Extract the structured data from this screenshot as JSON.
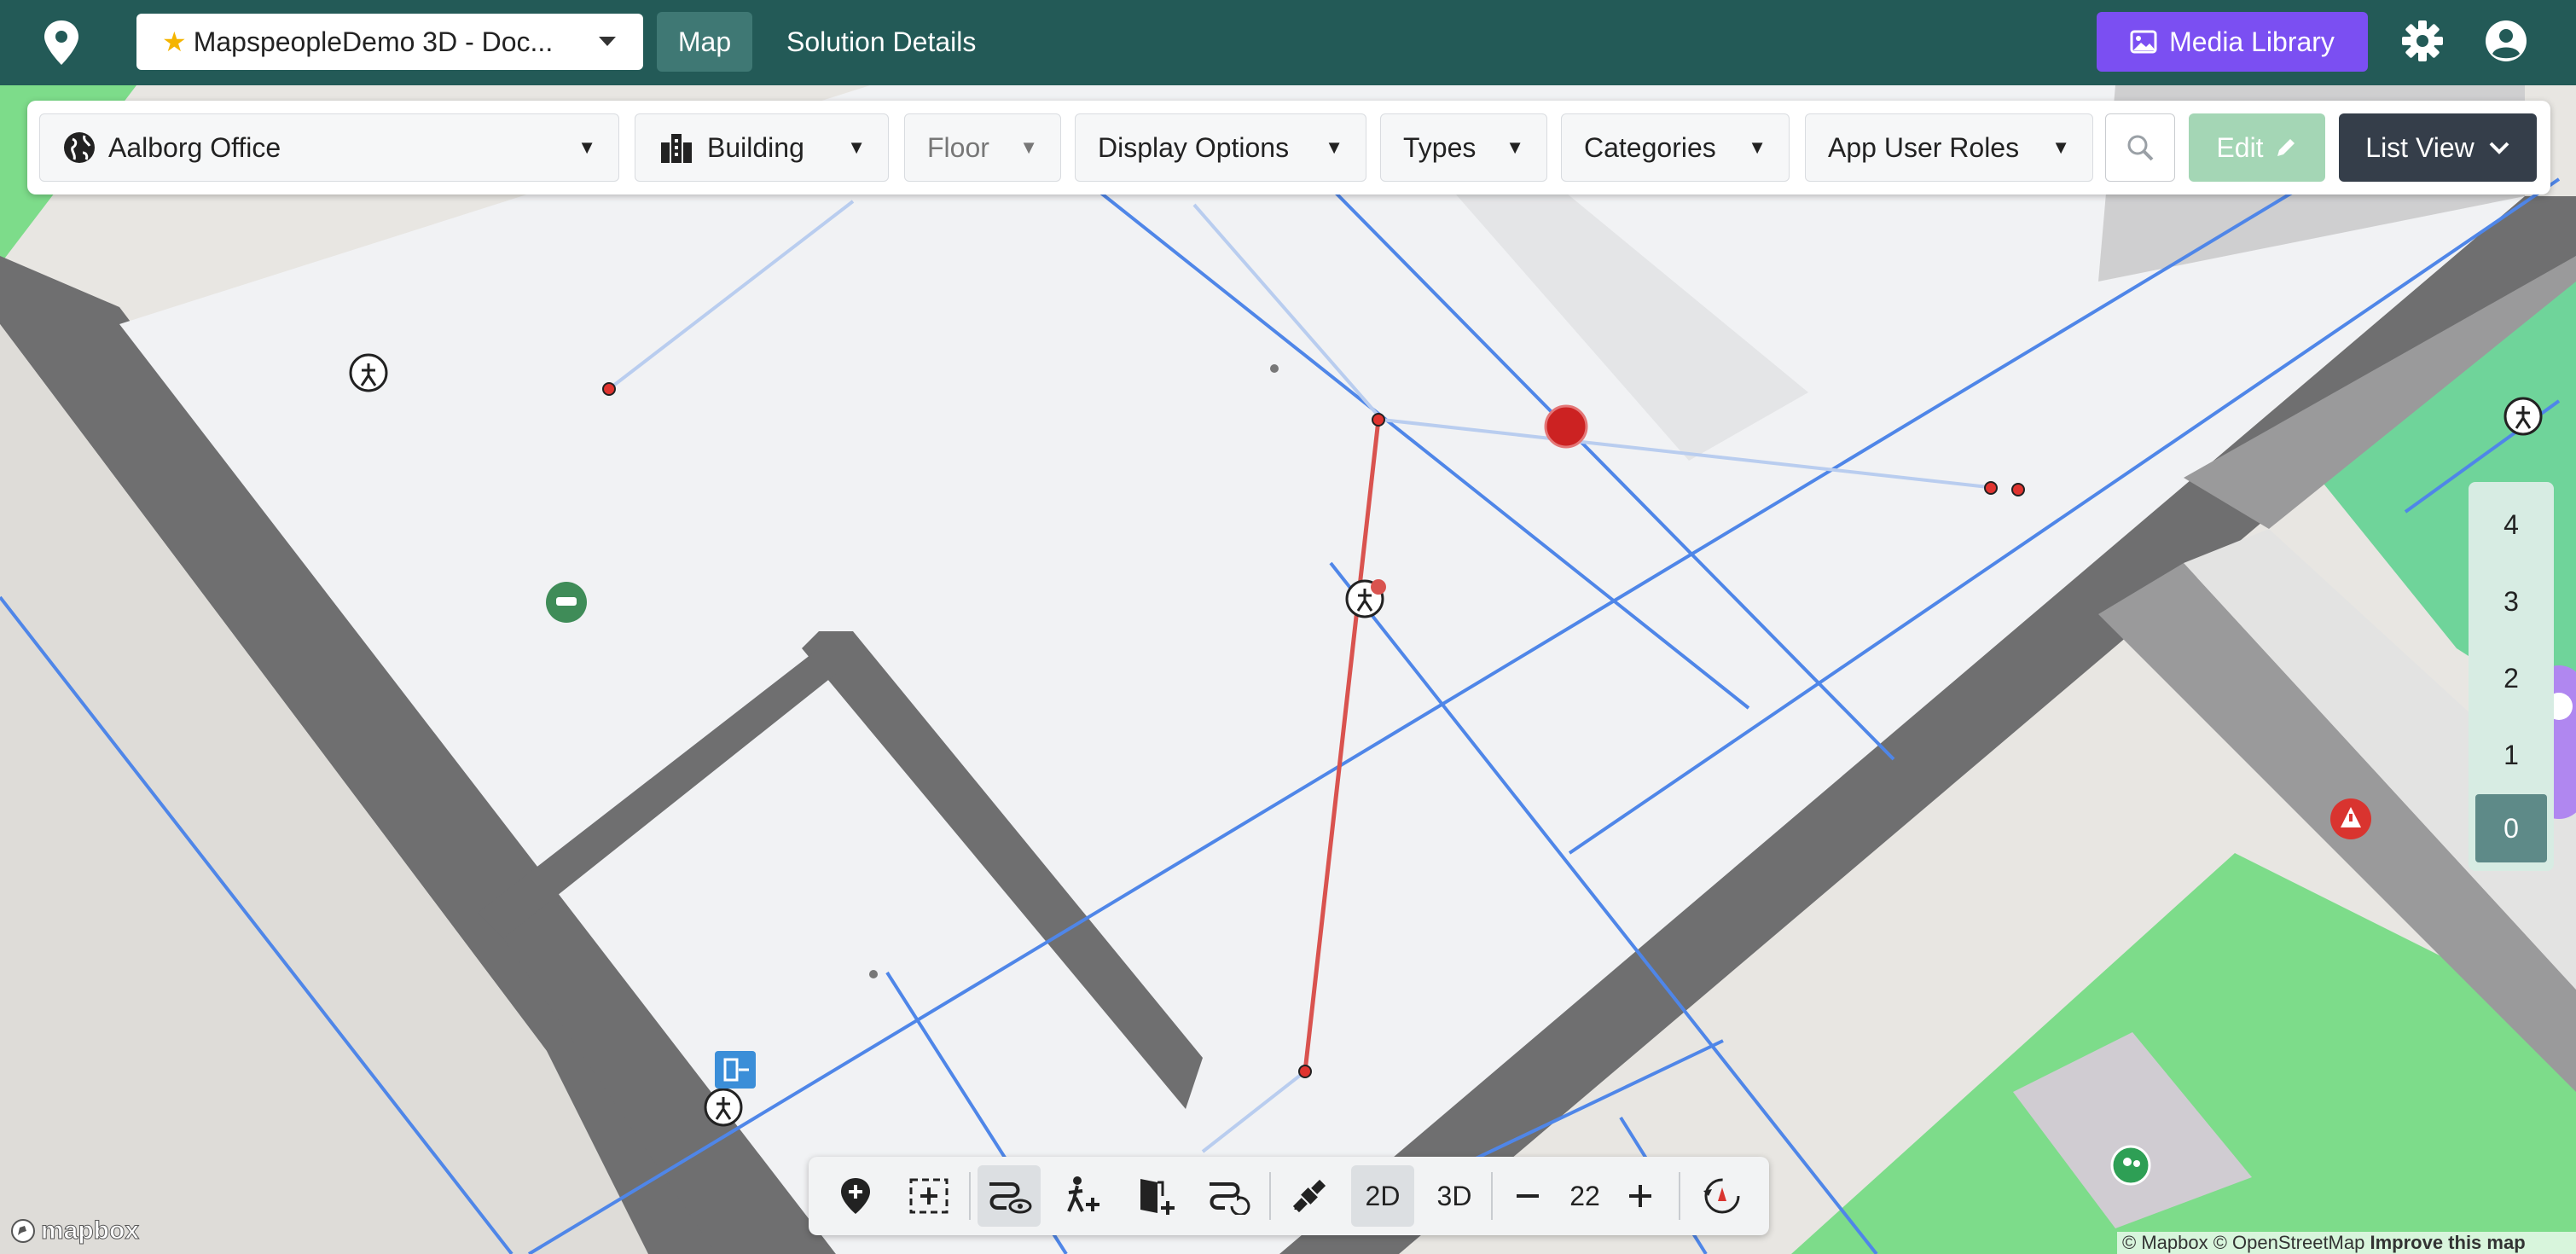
{
  "topbar": {
    "project_name": "MapspeopleDemo 3D - Doc...",
    "nav_map": "Map",
    "nav_solution": "Solution Details",
    "media_library": "Media Library",
    "icons": [
      "pin-logo-icon",
      "star-icon",
      "chevron-down-icon",
      "image-icon",
      "gear-icon",
      "user-icon"
    ]
  },
  "toolbar": {
    "venue": "Aalborg Office",
    "building": "Building",
    "floor": "Floor",
    "display_options": "Display Options",
    "types": "Types",
    "categories": "Categories",
    "app_user_roles": "App User Roles",
    "edit": "Edit",
    "list_view": "List View"
  },
  "floors": [
    "4",
    "3",
    "2",
    "1",
    "0"
  ],
  "active_floor": "0",
  "bottombar": {
    "mode_2d": "2D",
    "mode_3d": "3D",
    "zoom": "22",
    "active_mode": "2D"
  },
  "map": {
    "mapbox_logo": "mapbox",
    "attribution_mapbox": "© Mapbox",
    "attribution_osm": "© OpenStreetMap",
    "attribution_improve": "Improve this map"
  },
  "colors": {
    "topbar": "#235a57",
    "media_button": "#7b4ff2",
    "edit_button": "#a4d6b5",
    "list_view_button": "#353e4a",
    "route_line": "#4f86e8",
    "selected_line": "#d9534f",
    "grass": "#7ddc8a"
  }
}
